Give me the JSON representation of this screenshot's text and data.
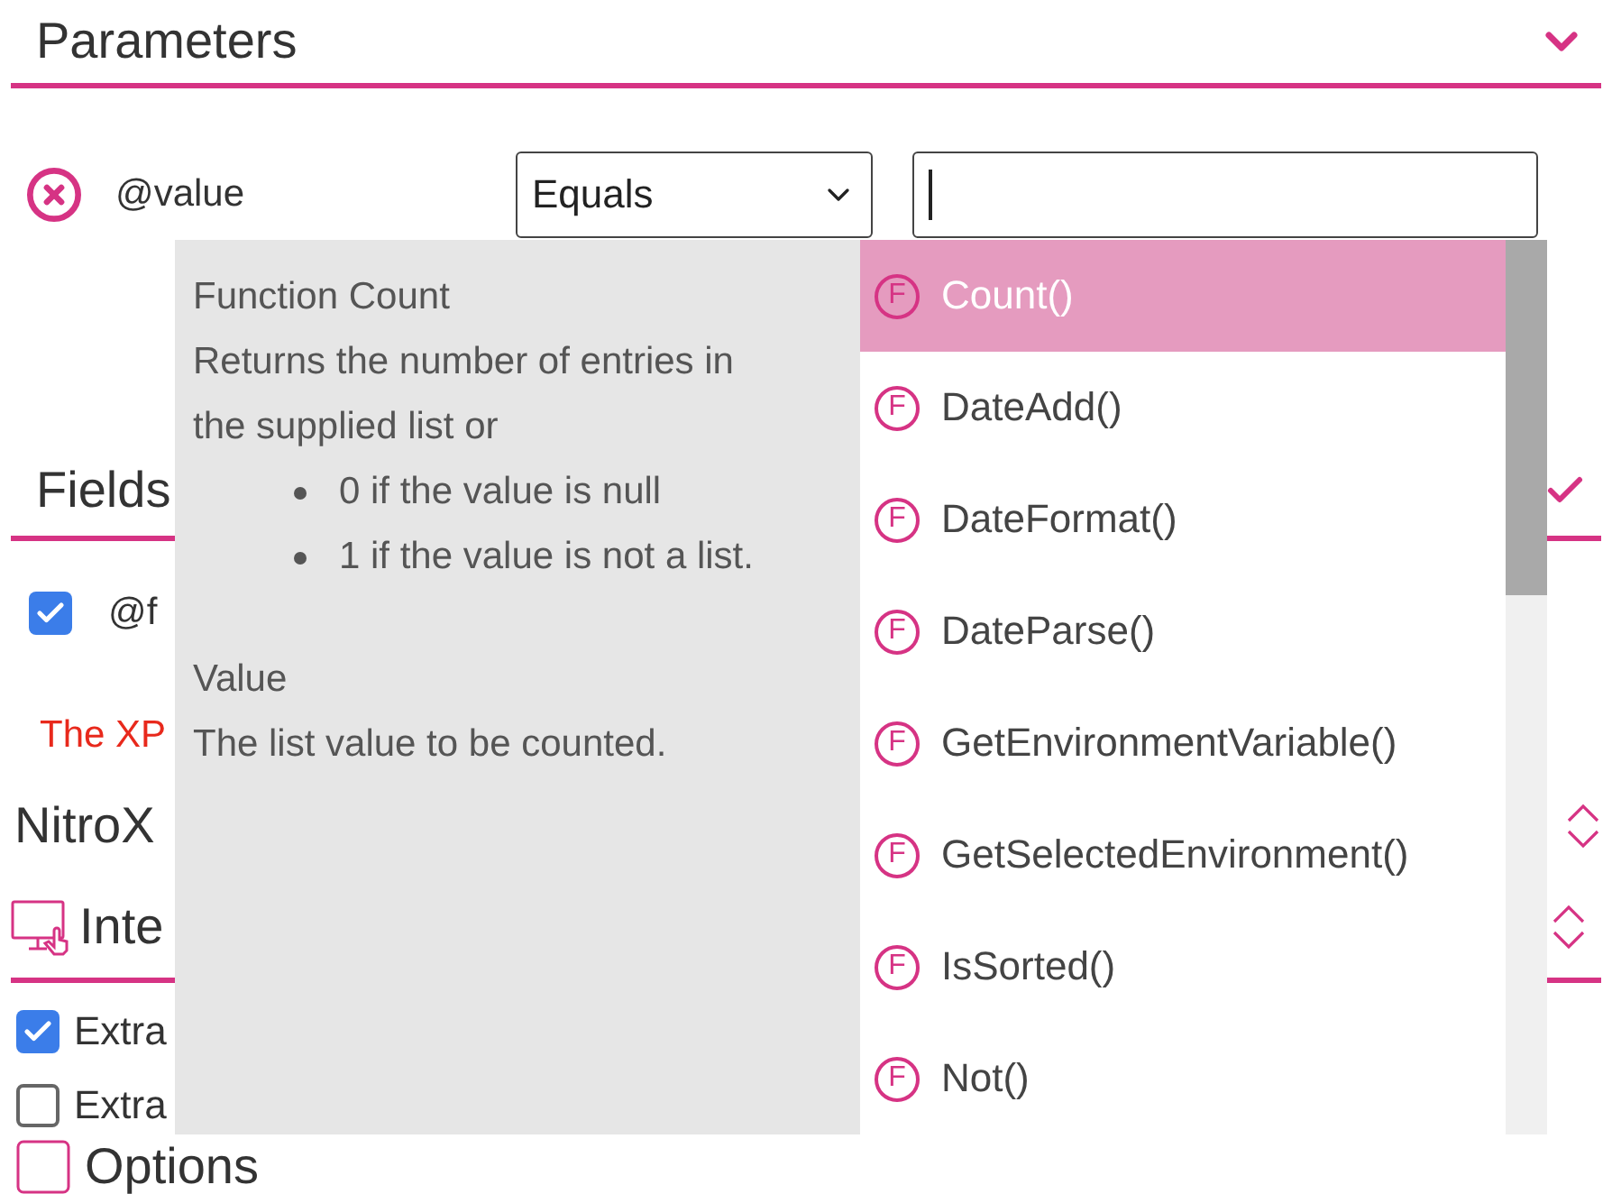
{
  "parameters": {
    "title": "Parameters",
    "rows": [
      {
        "name": "@value",
        "operator": "Equals"
      }
    ]
  },
  "fields": {
    "title": "Fields",
    "items": [
      {
        "label": "@f",
        "checked": true
      }
    ],
    "error": "The XP"
  },
  "nitrox": {
    "title": "NitroX"
  },
  "interface": {
    "title": "Inte",
    "options": [
      {
        "label": "Extra",
        "checked": true
      },
      {
        "label": "Extra",
        "checked": false
      }
    ]
  },
  "options": {
    "title": "Options"
  },
  "popup": {
    "help": {
      "title": "Function Count",
      "description": "Returns the number of entries in the supplied list or",
      "bullets": [
        "0 if the value is null",
        "1 if the value is not a list."
      ],
      "value_title": "Value",
      "value_description": "The list value to be counted."
    },
    "functions": [
      {
        "icon": "F",
        "label": "Count()",
        "selected": true
      },
      {
        "icon": "F",
        "label": "DateAdd()",
        "selected": false
      },
      {
        "icon": "F",
        "label": "DateFormat()",
        "selected": false
      },
      {
        "icon": "F",
        "label": "DateParse()",
        "selected": false
      },
      {
        "icon": "F",
        "label": "GetEnvironmentVariable()",
        "selected": false
      },
      {
        "icon": "F",
        "label": "GetSelectedEnvironment()",
        "selected": false
      },
      {
        "icon": "F",
        "label": "IsSorted()",
        "selected": false
      },
      {
        "icon": "F",
        "label": "Not()",
        "selected": false
      }
    ]
  }
}
